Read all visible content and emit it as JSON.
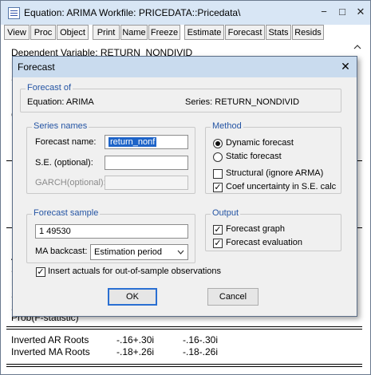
{
  "window": {
    "title": "Equation: ARIMA   Workfile: PRICEDATA::Pricedata\\",
    "controls": {
      "minimize": "−",
      "restore": "□",
      "close": "✕"
    }
  },
  "toolbar": [
    "View",
    "Proc",
    "Object",
    "Print",
    "Name",
    "Freeze",
    "Estimate",
    "Forecast",
    "Stats",
    "Resids"
  ],
  "background": {
    "dependent_line": "Dependent Variable: RETURN_NONDIVID",
    "left_fragments": [
      "D",
      "S",
      "I",
      "C",
      "N"
    ],
    "fragments2": [
      "P",
      "A",
      "S",
      "L",
      "S",
      "S"
    ],
    "prob_line": "Prob(F-statistic)",
    "roots": [
      {
        "label": "Inverted AR Roots",
        "v1": "-.16+.30i",
        "v2": "-.16-.30i"
      },
      {
        "label": "Inverted MA Roots",
        "v1": "-.18+.26i",
        "v2": "-.18-.26i"
      }
    ]
  },
  "dialog": {
    "title": "Forecast",
    "close": "✕",
    "forecast_of": {
      "group_label": "Forecast of",
      "equation": "Equation: ARIMA",
      "series": "Series: RETURN_NONDIVID"
    },
    "series_names": {
      "group_label": "Series names",
      "forecast_name_label": "Forecast name:",
      "forecast_name_value": "return_nonf",
      "se_label": "S.E. (optional):",
      "se_value": "",
      "garch_label": "GARCH(optional):",
      "garch_value": ""
    },
    "method": {
      "group_label": "Method",
      "dynamic": "Dynamic forecast",
      "static": "Static forecast",
      "selected": "dynamic",
      "structural": "Structural (ignore ARMA)",
      "structural_checked": false,
      "coef_uncertainty": "Coef uncertainty in S.E. calc",
      "coef_uncertainty_checked": true
    },
    "forecast_sample": {
      "group_label": "Forecast sample",
      "value": "1 49530",
      "ma_backcast_label": "MA backcast:",
      "ma_backcast_value": "Estimation period"
    },
    "output": {
      "group_label": "Output",
      "graph": "Forecast graph",
      "graph_checked": true,
      "evaluation": "Forecast evaluation",
      "evaluation_checked": true
    },
    "insert_actuals": "Insert actuals for out-of-sample observations",
    "insert_actuals_checked": true,
    "ok": "OK",
    "cancel": "Cancel"
  }
}
